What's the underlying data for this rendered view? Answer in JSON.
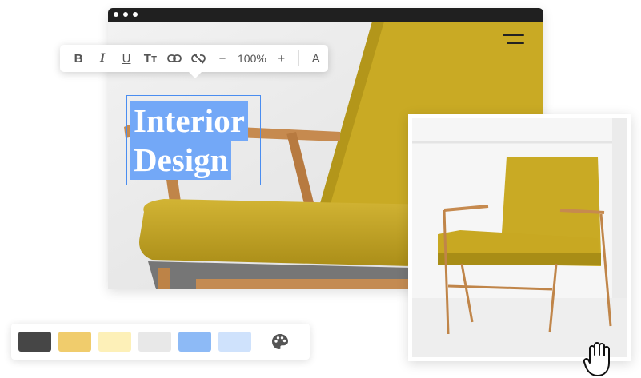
{
  "headline": {
    "line1": "Interior",
    "line2": "Design"
  },
  "toolbar": {
    "bold_label": "B",
    "italic_label": "I",
    "underline_label": "U",
    "text_size_label": "Tт",
    "zoom_out_label": "−",
    "zoom_value": "100%",
    "zoom_in_label": "+",
    "font_color_label": "A",
    "icons": [
      "link-icon",
      "unlink-icon"
    ]
  },
  "palette": {
    "swatches": [
      "#464646",
      "#f0cc6c",
      "#fdf0b8",
      "#e8e8e8",
      "#8dbaf6",
      "#cfe2fc"
    ],
    "icon": "palette-icon"
  },
  "colors": {
    "selection": "#73a8f7",
    "chair": "#c9a923",
    "wood": "#c78a4e"
  }
}
